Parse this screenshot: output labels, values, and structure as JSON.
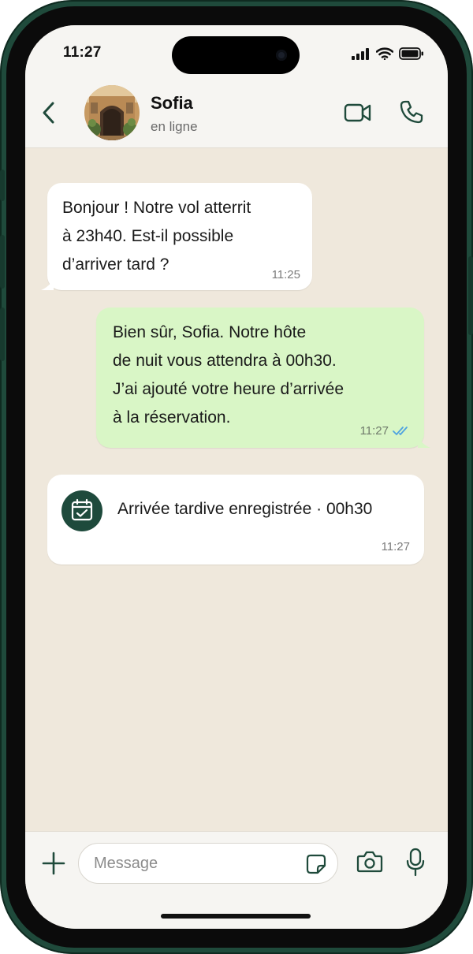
{
  "status_bar": {
    "time": "11:27"
  },
  "header": {
    "contact_name": "Sofia",
    "contact_status": "en ligne"
  },
  "messages": [
    {
      "direction": "incoming",
      "text": "Bonjour ! Notre vol atterrit\nà 23h40. Est-il possible\nd’arriver tard ?",
      "time": "11:25"
    },
    {
      "direction": "outgoing",
      "text": "Bien sûr, Sofia. Notre hôte\nde nuit vous attendra à 00h30.\nJ’ai ajouté votre heure d’arrivée\nà la réservation.",
      "time": "11:27",
      "read": true
    }
  ],
  "event_card": {
    "icon": "calendar-check-icon",
    "text": "Arrivée tardive enregistrée · 00h30",
    "time": "11:27"
  },
  "input": {
    "placeholder": "Message"
  },
  "colors": {
    "frame": "#1f4a3b",
    "outgoing_bubble": "#d9f6c6",
    "incoming_bubble": "#ffffff",
    "chat_background": "#efe8dc",
    "accent": "#1e4a3c",
    "read_ticks": "#4fa3e0"
  }
}
